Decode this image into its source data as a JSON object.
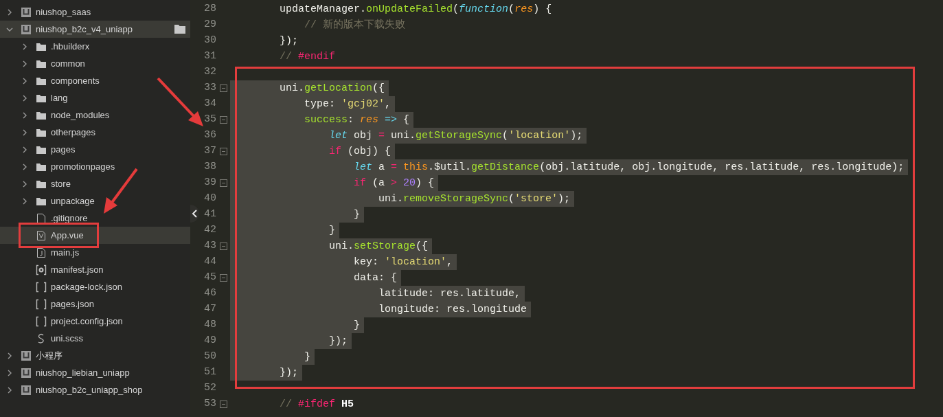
{
  "sidebar": {
    "items": [
      {
        "kind": "project",
        "label": "niushop_saas",
        "expanded": false,
        "selected": false
      },
      {
        "kind": "project",
        "label": "niushop_b2c_v4_uniapp",
        "expanded": true,
        "selected": true,
        "children": [
          {
            "kind": "folder",
            "label": ".hbuilderx",
            "expanded": false,
            "selected": false
          },
          {
            "kind": "folder",
            "label": "common",
            "expanded": false,
            "selected": false
          },
          {
            "kind": "folder",
            "label": "components",
            "expanded": false,
            "selected": false
          },
          {
            "kind": "folder",
            "label": "lang",
            "expanded": false,
            "selected": false
          },
          {
            "kind": "folder",
            "label": "node_modules",
            "expanded": false,
            "selected": false
          },
          {
            "kind": "folder",
            "label": "otherpages",
            "expanded": false,
            "selected": false
          },
          {
            "kind": "folder",
            "label": "pages",
            "expanded": false,
            "selected": false
          },
          {
            "kind": "folder",
            "label": "promotionpages",
            "expanded": false,
            "selected": false
          },
          {
            "kind": "folder",
            "label": "store",
            "expanded": false,
            "selected": false
          },
          {
            "kind": "folder",
            "label": "unpackage",
            "expanded": false,
            "selected": false
          },
          {
            "kind": "file-blank",
            "label": ".gitignore",
            "selected": false
          },
          {
            "kind": "file-vue",
            "label": "App.vue",
            "selected": true
          },
          {
            "kind": "file-js",
            "label": "main.js",
            "selected": false
          },
          {
            "kind": "file-config",
            "label": "manifest.json",
            "selected": false
          },
          {
            "kind": "file-json",
            "label": "package-lock.json",
            "selected": false
          },
          {
            "kind": "file-json",
            "label": "pages.json",
            "selected": false
          },
          {
            "kind": "file-json",
            "label": "project.config.json",
            "selected": false
          },
          {
            "kind": "file-style",
            "label": "uni.scss",
            "selected": false
          }
        ]
      },
      {
        "kind": "project",
        "label": "小程序",
        "expanded": false,
        "selected": false
      },
      {
        "kind": "project",
        "label": "niushop_liebian_uniapp",
        "expanded": false,
        "selected": false
      },
      {
        "kind": "project",
        "label": "niushop_b2c_uniapp_shop",
        "expanded": false,
        "selected": false
      }
    ]
  },
  "editor": {
    "lines": [
      {
        "number": "28",
        "fold": false,
        "selected": false,
        "tokens": [
          {
            "kind": "plain",
            "text": "        updateManager."
          },
          {
            "kind": "func",
            "text": "onUpdateFailed"
          },
          {
            "kind": "plain",
            "text": "("
          },
          {
            "kind": "storage",
            "text": "function"
          },
          {
            "kind": "plain",
            "text": "("
          },
          {
            "kind": "param",
            "text": "res"
          },
          {
            "kind": "plain",
            "text": ") {"
          }
        ]
      },
      {
        "number": "29",
        "fold": false,
        "selected": false,
        "tokens": [
          {
            "kind": "comment",
            "text": "            // 新的版本下载失败"
          }
        ]
      },
      {
        "number": "30",
        "fold": false,
        "selected": false,
        "tokens": [
          {
            "kind": "plain",
            "text": "        });"
          }
        ]
      },
      {
        "number": "31",
        "fold": false,
        "selected": false,
        "tokens": [
          {
            "kind": "comment",
            "text": "        // "
          },
          {
            "kind": "directive",
            "text": "#endif"
          }
        ]
      },
      {
        "number": "32",
        "fold": false
      },
      {
        "number": "33",
        "fold": true,
        "selected": true,
        "tokens": [
          {
            "kind": "plain",
            "text": "        uni."
          },
          {
            "kind": "func",
            "text": "getLocation"
          },
          {
            "kind": "plain",
            "text": "({"
          }
        ]
      },
      {
        "number": "34",
        "fold": false,
        "selected": true,
        "tokens": [
          {
            "kind": "plain",
            "text": "            type: "
          },
          {
            "kind": "string",
            "text": "'gcj02'"
          },
          {
            "kind": "plain",
            "text": ","
          }
        ]
      },
      {
        "number": "35",
        "fold": true,
        "selected": true,
        "tokens": [
          {
            "kind": "func",
            "text": "            success"
          },
          {
            "kind": "plain",
            "text": ": "
          },
          {
            "kind": "param",
            "text": "res"
          },
          {
            "kind": "arrow",
            "text": " =>"
          },
          {
            "kind": "plain",
            "text": " {"
          }
        ]
      },
      {
        "number": "36",
        "fold": false,
        "selected": true,
        "tokens": [
          {
            "kind": "storage",
            "text": "                let"
          },
          {
            "kind": "plain",
            "text": " obj "
          },
          {
            "kind": "keyword",
            "text": "="
          },
          {
            "kind": "plain",
            "text": " uni."
          },
          {
            "kind": "func",
            "text": "getStorageSync"
          },
          {
            "kind": "plain",
            "text": "("
          },
          {
            "kind": "string",
            "text": "'location'"
          },
          {
            "kind": "plain",
            "text": ");"
          }
        ]
      },
      {
        "number": "37",
        "fold": true,
        "selected": true,
        "tokens": [
          {
            "kind": "keyword",
            "text": "                if"
          },
          {
            "kind": "plain",
            "text": " (obj) {"
          }
        ]
      },
      {
        "number": "38",
        "fold": false,
        "selected": true,
        "tokens": [
          {
            "kind": "storage",
            "text": "                    let"
          },
          {
            "kind": "plain",
            "text": " a "
          },
          {
            "kind": "keyword",
            "text": "="
          },
          {
            "kind": "this",
            "text": " this"
          },
          {
            "kind": "plain",
            "text": ".$util."
          },
          {
            "kind": "func",
            "text": "getDistance"
          },
          {
            "kind": "plain",
            "text": "(obj.latitude, obj.longitude, res.latitude, res.longitude);"
          }
        ]
      },
      {
        "number": "39",
        "fold": true,
        "selected": true,
        "tokens": [
          {
            "kind": "keyword",
            "text": "                    if"
          },
          {
            "kind": "plain",
            "text": " (a "
          },
          {
            "kind": "keyword",
            "text": ">"
          },
          {
            "kind": "number",
            "text": " 20"
          },
          {
            "kind": "plain",
            "text": ") {"
          }
        ]
      },
      {
        "number": "40",
        "fold": false,
        "selected": true,
        "tokens": [
          {
            "kind": "plain",
            "text": "                        uni."
          },
          {
            "kind": "func",
            "text": "removeStorageSync"
          },
          {
            "kind": "plain",
            "text": "("
          },
          {
            "kind": "string",
            "text": "'store'"
          },
          {
            "kind": "plain",
            "text": ");"
          }
        ]
      },
      {
        "number": "41",
        "fold": false,
        "selected": true,
        "tokens": [
          {
            "kind": "plain",
            "text": "                    }"
          }
        ]
      },
      {
        "number": "42",
        "fold": false,
        "selected": true,
        "tokens": [
          {
            "kind": "plain",
            "text": "                }"
          }
        ]
      },
      {
        "number": "43",
        "fold": true,
        "selected": true,
        "tokens": [
          {
            "kind": "plain",
            "text": "                uni."
          },
          {
            "kind": "func",
            "text": "setStorage"
          },
          {
            "kind": "plain",
            "text": "({"
          }
        ]
      },
      {
        "number": "44",
        "fold": false,
        "selected": true,
        "tokens": [
          {
            "kind": "plain",
            "text": "                    key: "
          },
          {
            "kind": "string",
            "text": "'location'"
          },
          {
            "kind": "plain",
            "text": ","
          }
        ]
      },
      {
        "number": "45",
        "fold": true,
        "selected": true,
        "tokens": [
          {
            "kind": "plain",
            "text": "                    data: {"
          }
        ]
      },
      {
        "number": "46",
        "fold": false,
        "selected": true,
        "tokens": [
          {
            "kind": "plain",
            "text": "                        latitude: res.latitude,"
          }
        ]
      },
      {
        "number": "47",
        "fold": false,
        "selected": true,
        "tokens": [
          {
            "kind": "plain",
            "text": "                        longitude: res.longitude"
          }
        ]
      },
      {
        "number": "48",
        "fold": false,
        "selected": true,
        "tokens": [
          {
            "kind": "plain",
            "text": "                    }"
          }
        ]
      },
      {
        "number": "49",
        "fold": false,
        "selected": true,
        "tokens": [
          {
            "kind": "plain",
            "text": "                });"
          }
        ]
      },
      {
        "number": "50",
        "fold": false,
        "selected": true,
        "tokens": [
          {
            "kind": "plain",
            "text": "            }"
          }
        ]
      },
      {
        "number": "51",
        "fold": false,
        "selected": true,
        "tokens": [
          {
            "kind": "plain",
            "text": "        });"
          }
        ]
      },
      {
        "number": "52",
        "fold": false
      },
      {
        "number": "53",
        "fold": true,
        "selected": false,
        "tokens": [
          {
            "kind": "comment",
            "text": "        // "
          },
          {
            "kind": "directive",
            "text": "#ifdef"
          },
          {
            "kind": "bold",
            "text": " H5"
          }
        ]
      }
    ]
  }
}
